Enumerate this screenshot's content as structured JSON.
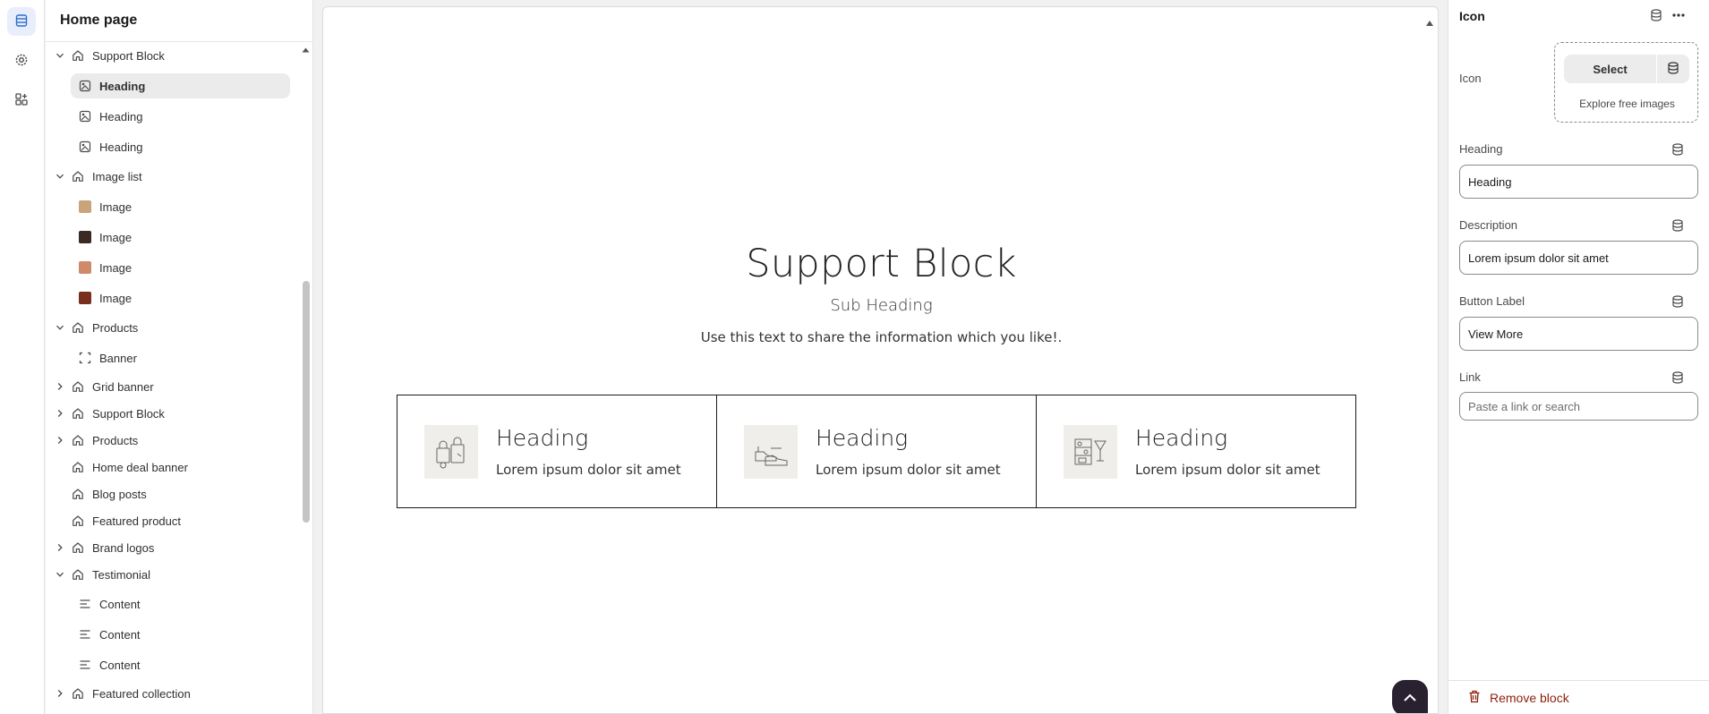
{
  "sidebar": {
    "title": "Home page",
    "tree": [
      {
        "kind": "section",
        "label": "Support Block",
        "expanded": true,
        "icon": "house-icon"
      },
      {
        "kind": "child",
        "label": "Heading",
        "icon": "image-heading-icon",
        "selected": true
      },
      {
        "kind": "child",
        "label": "Heading",
        "icon": "image-heading-icon"
      },
      {
        "kind": "child",
        "label": "Heading",
        "icon": "image-heading-icon"
      },
      {
        "kind": "section",
        "label": "Image list",
        "expanded": true,
        "icon": "house-icon"
      },
      {
        "kind": "child",
        "label": "Image",
        "icon": "thumbnail",
        "color": "#c9a47a"
      },
      {
        "kind": "child",
        "label": "Image",
        "icon": "thumbnail",
        "color": "#3a2a22"
      },
      {
        "kind": "child",
        "label": "Image",
        "icon": "thumbnail",
        "color": "#d08a6a"
      },
      {
        "kind": "child",
        "label": "Image",
        "icon": "thumbnail",
        "color": "#7a2e1e"
      },
      {
        "kind": "section",
        "label": "Products",
        "expanded": true,
        "icon": "house-icon"
      },
      {
        "kind": "child",
        "label": "Banner",
        "icon": "banner-frame-icon"
      },
      {
        "kind": "section",
        "label": "Grid banner",
        "expanded": false,
        "icon": "house-icon"
      },
      {
        "kind": "section",
        "label": "Support Block",
        "expanded": false,
        "icon": "house-icon"
      },
      {
        "kind": "section",
        "label": "Products",
        "expanded": false,
        "icon": "house-icon"
      },
      {
        "kind": "section",
        "label": "Home deal banner",
        "noChevron": true,
        "icon": "house-icon"
      },
      {
        "kind": "section",
        "label": "Blog posts",
        "noChevron": true,
        "icon": "house-icon"
      },
      {
        "kind": "section",
        "label": "Featured product",
        "noChevron": true,
        "icon": "house-icon"
      },
      {
        "kind": "section",
        "label": "Brand logos",
        "expanded": false,
        "icon": "house-icon"
      },
      {
        "kind": "section",
        "label": "Testimonial",
        "expanded": true,
        "icon": "house-icon"
      },
      {
        "kind": "child",
        "label": "Content",
        "icon": "text-lines-icon"
      },
      {
        "kind": "child",
        "label": "Content",
        "icon": "text-lines-icon"
      },
      {
        "kind": "child",
        "label": "Content",
        "icon": "text-lines-icon"
      },
      {
        "kind": "section",
        "label": "Featured collection",
        "expanded": false,
        "icon": "house-icon"
      }
    ]
  },
  "preview": {
    "title": "Support Block",
    "subheading": "Sub Heading",
    "description": "Use this text to share the information which you like!.",
    "cards": [
      {
        "heading": "Heading",
        "text": "Lorem ipsum dolor sit amet",
        "icon": "shopping-bags-icon"
      },
      {
        "heading": "Heading",
        "text": "Lorem ipsum dolor sit amet",
        "icon": "shoes-icon"
      },
      {
        "heading": "Heading",
        "text": "Lorem ipsum dolor sit amet",
        "icon": "shelf-cocktail-icon"
      }
    ]
  },
  "panel": {
    "title": "Icon",
    "icon_label": "Icon",
    "select_label": "Select",
    "explore_label": "Explore free images",
    "heading_label": "Heading",
    "heading_value": "Heading",
    "description_label": "Description",
    "description_value": "Lorem ipsum dolor sit amet",
    "button_label_label": "Button Label",
    "button_label_value": "View More",
    "link_label": "Link",
    "link_placeholder": "Paste a link or search",
    "remove_label": "Remove block"
  },
  "colors": {
    "accent": "#2c6ecb",
    "danger": "#8e1f0b",
    "backtop": "#2a2130"
  }
}
